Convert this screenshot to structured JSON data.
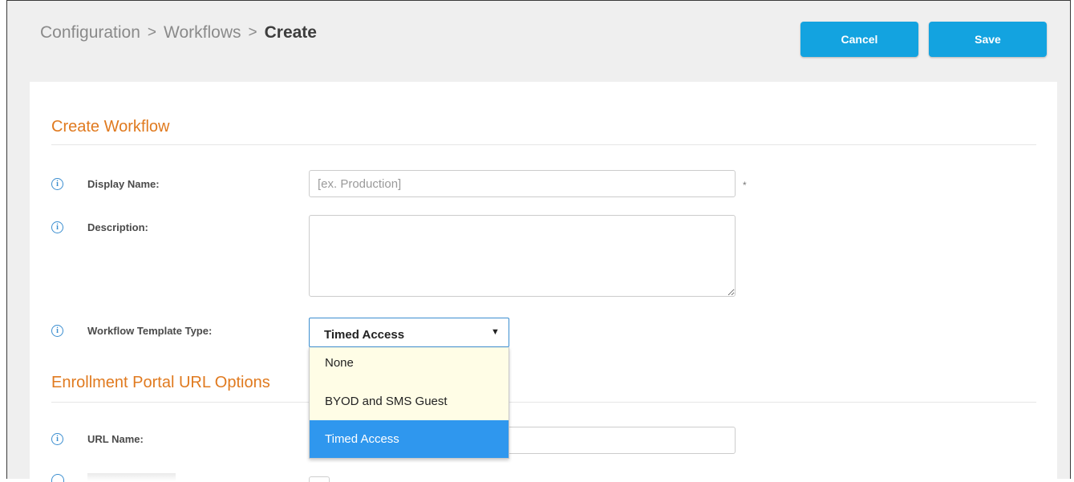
{
  "breadcrumb": {
    "root": "Configuration",
    "sep1": ">",
    "middle": "Workflows",
    "sep2": ">",
    "current": "Create"
  },
  "header": {
    "cancel_label": "Cancel",
    "save_label": "Save"
  },
  "create_workflow": {
    "title": "Create Workflow",
    "display_name_label": "Display Name:",
    "display_name_placeholder": "[ex. Production]",
    "required_marker": "*",
    "description_label": "Description:",
    "template_type_label": "Workflow Template Type:",
    "template_type_value": "Timed Access",
    "template_options": [
      "None",
      "BYOD and SMS Guest",
      "Timed Access"
    ]
  },
  "enrollment": {
    "title": "Enrollment Portal URL Options",
    "url_name_label": "URL Name:"
  },
  "icons": {
    "info": "i",
    "caret": "▼"
  },
  "colors": {
    "accent_button": "#13a3e0",
    "section_title": "#e07a1f",
    "selected_option": "#2f97ee"
  }
}
